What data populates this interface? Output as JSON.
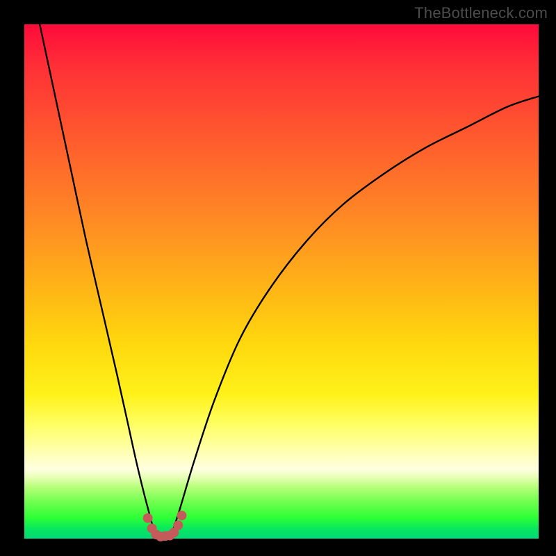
{
  "watermark": "TheBottleneck.com",
  "colors": {
    "frame": "#000000",
    "curve": "#000000",
    "dots": "#c45a5a",
    "gradient_stops": [
      "#ff0a3a",
      "#ff5a2e",
      "#ffb716",
      "#fff21a",
      "#ffffe0",
      "#6dff4d",
      "#00d877"
    ]
  },
  "chart_data": {
    "type": "line",
    "title": "",
    "xlabel": "",
    "ylabel": "",
    "xlim": [
      0,
      100
    ],
    "ylim": [
      0,
      100
    ],
    "grid": false,
    "legend": null,
    "note": "V-shaped bottleneck curve. x is a normalized horizontal position 0–100 across the plot; y is a normalized bottleneck percentage 0–100 (0 at bottom, 100 at top). Values estimated from the image.",
    "series": [
      {
        "name": "bottleneck-curve",
        "x": [
          3,
          6,
          9,
          12,
          15,
          18,
          20,
          22,
          24,
          25.5,
          27,
          28.5,
          30,
          33,
          37,
          42,
          48,
          55,
          62,
          70,
          78,
          86,
          94,
          100
        ],
        "y": [
          100,
          86,
          72,
          58,
          45,
          32,
          23,
          14,
          6,
          1,
          0.5,
          1,
          5,
          15,
          27,
          39,
          49,
          58,
          65,
          71,
          76,
          80,
          84,
          86
        ]
      }
    ],
    "markers": {
      "name": "valley-dots",
      "color": "#c45a5a",
      "points": [
        {
          "x": 24.0,
          "y": 4.0
        },
        {
          "x": 24.8,
          "y": 2.0
        },
        {
          "x": 25.6,
          "y": 0.8
        },
        {
          "x": 26.5,
          "y": 0.4
        },
        {
          "x": 27.4,
          "y": 0.5
        },
        {
          "x": 28.3,
          "y": 0.6
        },
        {
          "x": 29.1,
          "y": 1.2
        },
        {
          "x": 29.9,
          "y": 2.6
        },
        {
          "x": 30.6,
          "y": 4.5
        }
      ]
    }
  }
}
